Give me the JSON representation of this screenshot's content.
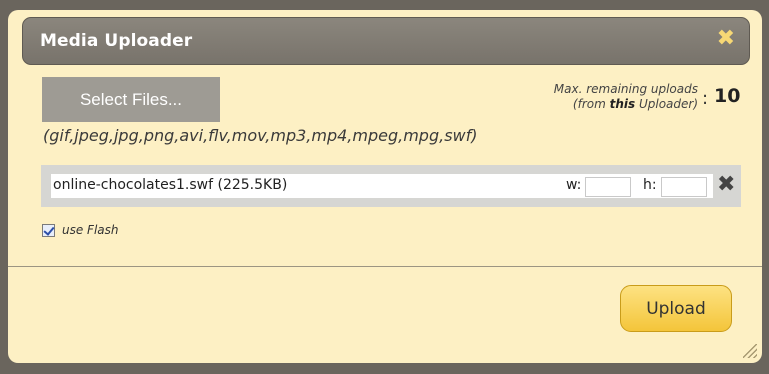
{
  "dialog": {
    "title": "Media Uploader",
    "close_glyph": "✖",
    "colors": {
      "titlebar": "#807b73",
      "panel": "#fdf0c4",
      "accent": "#f7d875",
      "upload_button": "#f6cc4a"
    }
  },
  "select_files_label": "Select Files...",
  "formats_text": "(gif,jpeg,jpg,png,avi,flv,mov,mp3,mp4,mpeg,mpg,swf)",
  "max_uploads": {
    "line1": "Max. remaining uploads",
    "line2_prefix": "(from ",
    "line2_bold": "this",
    "line2_suffix": " Uploader)",
    "colon": ":",
    "count": "10"
  },
  "file": {
    "name": "online-chocolates1.swf (225.5KB)",
    "width_label": "w:",
    "height_label": "h:",
    "width_value": "",
    "height_value": "",
    "remove_glyph": "✖",
    "remove_icon": "close-x-icon"
  },
  "use_flash": {
    "label": "use Flash",
    "checked": true
  },
  "upload_label": "Upload",
  "icons": {
    "close": "close-icon",
    "checkbox": "checkmark-icon",
    "resize": "resize-grip-icon"
  }
}
